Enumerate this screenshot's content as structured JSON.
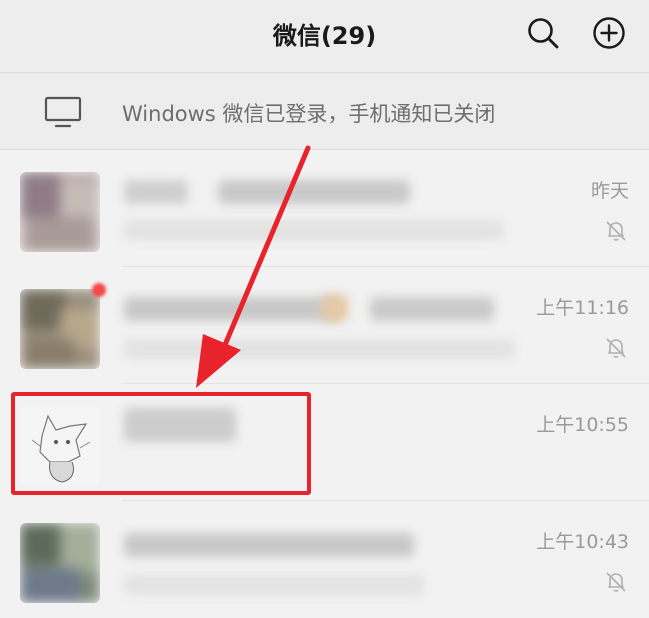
{
  "header": {
    "title": "微信(29)",
    "search_icon": "search-icon",
    "add_icon": "plus-circle-icon"
  },
  "banner": {
    "icon": "monitor-icon",
    "text": "Windows 微信已登录，手机通知已关闭"
  },
  "chats": [
    {
      "time": "昨天",
      "muted": true,
      "unread_dot": false,
      "highlighted": false
    },
    {
      "time": "上午11:16",
      "muted": true,
      "unread_dot": true,
      "highlighted": false
    },
    {
      "time": "上午10:55",
      "muted": false,
      "unread_dot": false,
      "highlighted": true
    },
    {
      "time": "上午10:43",
      "muted": true,
      "unread_dot": false,
      "highlighted": false
    }
  ],
  "colors": {
    "annotation": "#e8232b",
    "badge": "#f24a4a",
    "background": "#ededed"
  }
}
